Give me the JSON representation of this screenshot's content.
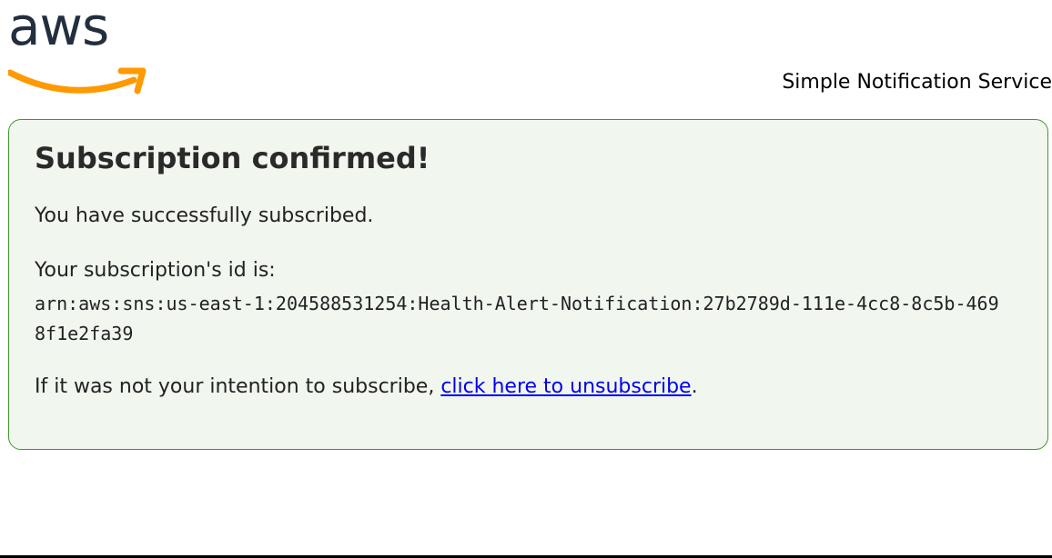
{
  "header": {
    "logo_text": "aws",
    "service_name": "Simple Notification Service"
  },
  "panel": {
    "title": "Subscription confirmed!",
    "success_message": "You have successfully subscribed.",
    "id_label": "Your subscription's id is:",
    "subscription_arn": "arn:aws:sns:us-east-1:204588531254:Health-Alert-Notification:27b2789d-111e-4cc8-8c5b-4698f1e2fa39",
    "unsubscribe_prefix": "If it was not your intention to subscribe, ",
    "unsubscribe_link": "click here to unsubscribe",
    "unsubscribe_suffix": "."
  },
  "colors": {
    "panel_border": "#3f9a2b",
    "panel_background": "#f1f6ef",
    "logo_smile": "#ff9900",
    "link": "#0000ee"
  },
  "icons": {
    "logo": "aws-logo-icon"
  }
}
